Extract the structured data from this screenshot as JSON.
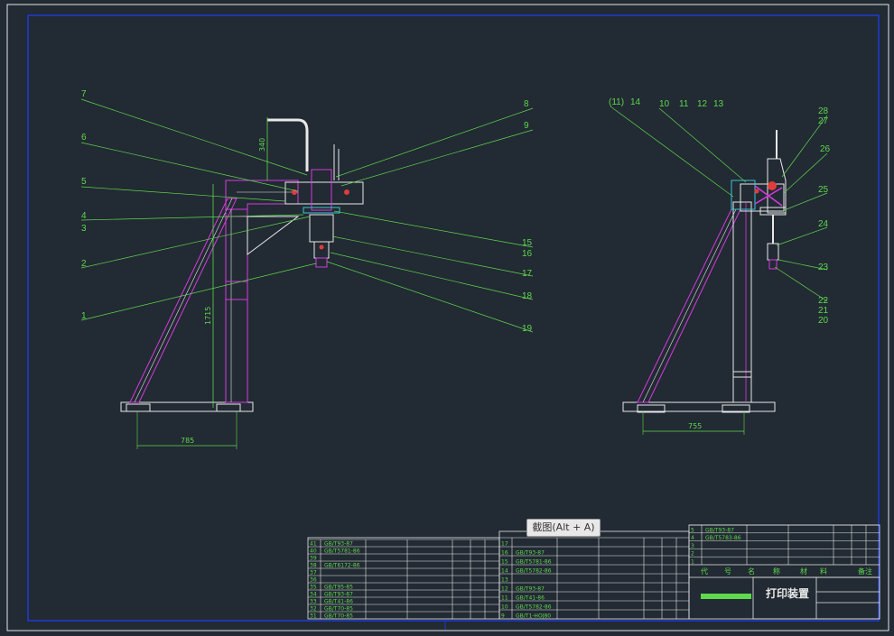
{
  "drawing": {
    "colors": {
      "background": "#222a33",
      "outer_frame": "#e6e6e6",
      "inner_frame": "#1f3bd6",
      "structure": "#e8e8e8",
      "part": "#d63adf",
      "leader": "#5fd84e",
      "dimension": "#5fd84e",
      "table_line": "#e8e8e8",
      "table_text": "#5fd84e",
      "accent_red": "#e13c3c",
      "accent_cyan": "#39c6d6"
    },
    "front_view": {
      "callouts_left": [
        "7",
        "6",
        "5",
        "4",
        "3",
        "2",
        "1"
      ],
      "callouts_right": [
        "8",
        "9",
        "15",
        "16",
        "17",
        "18",
        "19"
      ],
      "dim_bottom": "785",
      "dim_height": "1715",
      "dim_top": "340"
    },
    "side_view": {
      "callouts_top": [
        "(11)",
        "14",
        "10",
        "11",
        "12",
        "13"
      ],
      "callouts_right": [
        "28",
        "27",
        "26",
        "25",
        "24",
        "23",
        "22",
        "21",
        "20"
      ],
      "dim_bottom": "755"
    },
    "title_block": {
      "title": "打印装置",
      "header_labels": [
        "代",
        "号",
        "名",
        "称",
        "材",
        "料",
        "备注"
      ]
    },
    "parts_list_left": [
      {
        "no": "41",
        "code": "GB/T93-87"
      },
      {
        "no": "40",
        "code": "GB/T5781-86"
      },
      {
        "no": "39",
        "code": ""
      },
      {
        "no": "38",
        "code": "GB/T6172-86"
      },
      {
        "no": "37",
        "code": ""
      },
      {
        "no": "36",
        "code": ""
      },
      {
        "no": "35",
        "code": "GB/T95-85"
      },
      {
        "no": "34",
        "code": "GB/T93-87"
      },
      {
        "no": "33",
        "code": "GB/T41-86"
      },
      {
        "no": "32",
        "code": "GB/T70-85"
      },
      {
        "no": "31",
        "code": "GB/T70-85"
      }
    ],
    "parts_list_mid": [
      {
        "no": "17",
        "code": ""
      },
      {
        "no": "16",
        "code": "GB/T93-87"
      },
      {
        "no": "15",
        "code": "GB/T5781-86"
      },
      {
        "no": "14",
        "code": "GB/T5782-86"
      },
      {
        "no": "13",
        "code": ""
      },
      {
        "no": "12",
        "code": "GB/T93-87"
      },
      {
        "no": "11",
        "code": "GB/T41-86"
      },
      {
        "no": "10",
        "code": "GB/T5782-86"
      },
      {
        "no": "9",
        "code": "GB/T1-HOJ80"
      }
    ],
    "parts_list_right": [
      {
        "no": "5",
        "code": "GB/T93-87"
      },
      {
        "no": "4",
        "code": "GB/T5783-86"
      },
      {
        "no": "3",
        "code": ""
      },
      {
        "no": "2",
        "code": ""
      },
      {
        "no": "1",
        "code": ""
      }
    ]
  },
  "tooltip": {
    "text": "截图(Alt + A)"
  }
}
